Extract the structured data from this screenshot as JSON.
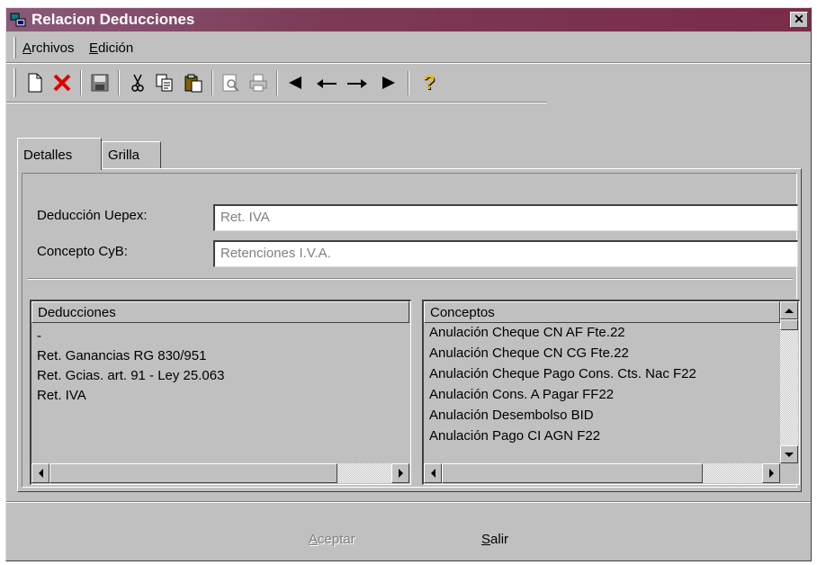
{
  "window": {
    "title": "Relacion Deducciones",
    "close_glyph": "✕"
  },
  "menu": [
    {
      "label_mnemonic": "A",
      "label_rest": "rchivos"
    },
    {
      "label_mnemonic": "E",
      "label_rest": "dición"
    }
  ],
  "toolbar": {
    "icons": [
      "new-icon",
      "delete-icon",
      "save-icon",
      "cut-icon",
      "copy-icon",
      "paste-icon",
      "print-preview-icon",
      "print-icon",
      "first-icon",
      "previous-icon",
      "next-icon",
      "last-icon",
      "help-icon"
    ],
    "help_glyph": "?"
  },
  "tabs": [
    {
      "label": "Detalles"
    },
    {
      "label": "Grilla"
    }
  ],
  "form": {
    "deduccion_label": "Deducción Uepex:",
    "deduccion_value": "Ret. IVA",
    "concepto_label": "Concepto CyB:",
    "concepto_value": "Retenciones I.V.A."
  },
  "deducciones": {
    "header": "Deducciones",
    "items": [
      "-",
      "Ret. Ganancias RG 830/951",
      "Ret. Gcias. art. 91 - Ley 25.063",
      "Ret. IVA"
    ]
  },
  "conceptos": {
    "header": "Conceptos",
    "items": [
      "Anulación Cheque CN AF Fte.22",
      "Anulación Cheque CN CG Fte.22",
      "Anulación Cheque Pago Cons. Cts. Nac F22",
      "Anulación Cons. A Pagar FF22",
      "Anulación Desembolso BID",
      "Anulación Pago CI AGN F22"
    ]
  },
  "buttons": {
    "aceptar_mnemonic": "A",
    "aceptar_rest": "ceptar",
    "salir_mnemonic": "S",
    "salir_rest": "alir"
  },
  "colors": {
    "title_bar": "#7a2b4a",
    "window_bg": "#c0c0c0"
  }
}
